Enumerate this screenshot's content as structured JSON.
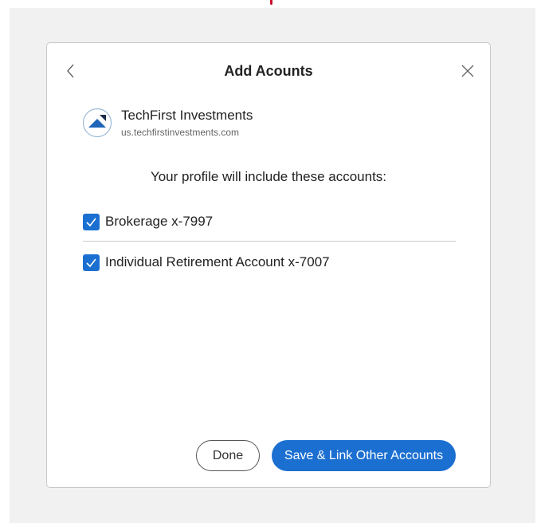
{
  "modal": {
    "title": "Add Acounts",
    "institution": {
      "name": "TechFirst Investments",
      "url": "us.techfirstinvestments.com",
      "logo_icon": "techfirst-logo-icon"
    },
    "profile_note": "Your profile will include these accounts:",
    "accounts": [
      {
        "label": "Brokerage x-7997",
        "checked": true
      },
      {
        "label": "Individual Retirement Account x-7007",
        "checked": true
      }
    ],
    "buttons": {
      "done": "Done",
      "save_link": "Save & Link Other Accounts"
    }
  },
  "colors": {
    "accent": "#1b6fd1",
    "backdrop": "#f1f1f1",
    "top_marker": "#c8102e"
  }
}
